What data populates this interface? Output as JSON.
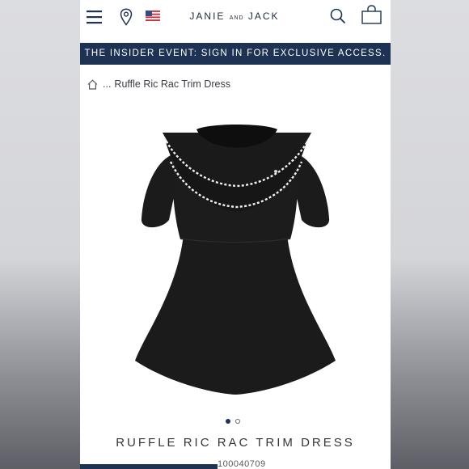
{
  "header": {
    "brand_main": "JANIE",
    "brand_and": "AND",
    "brand_end": "JACK",
    "icons": [
      "menu-icon",
      "location-pin-icon",
      "us-flag-icon",
      "search-icon",
      "shopping-bag-icon"
    ]
  },
  "promo": {
    "text": "THE INSIDER EVENT: SIGN IN FOR EXCLUSIVE ACCESS."
  },
  "breadcrumb": {
    "ellipsis": "...",
    "current": "Ruffle Ric Rac Trim Dress"
  },
  "gallery": {
    "image_count": 2,
    "active_index": 0
  },
  "product": {
    "title": "RUFFLE RIC RAC TRIM DRESS",
    "sku": "100040709"
  },
  "colors": {
    "navy": "#1e3353",
    "text": "#33363c",
    "dress": "#1b1b1c",
    "trim": "#f2f2f2"
  }
}
